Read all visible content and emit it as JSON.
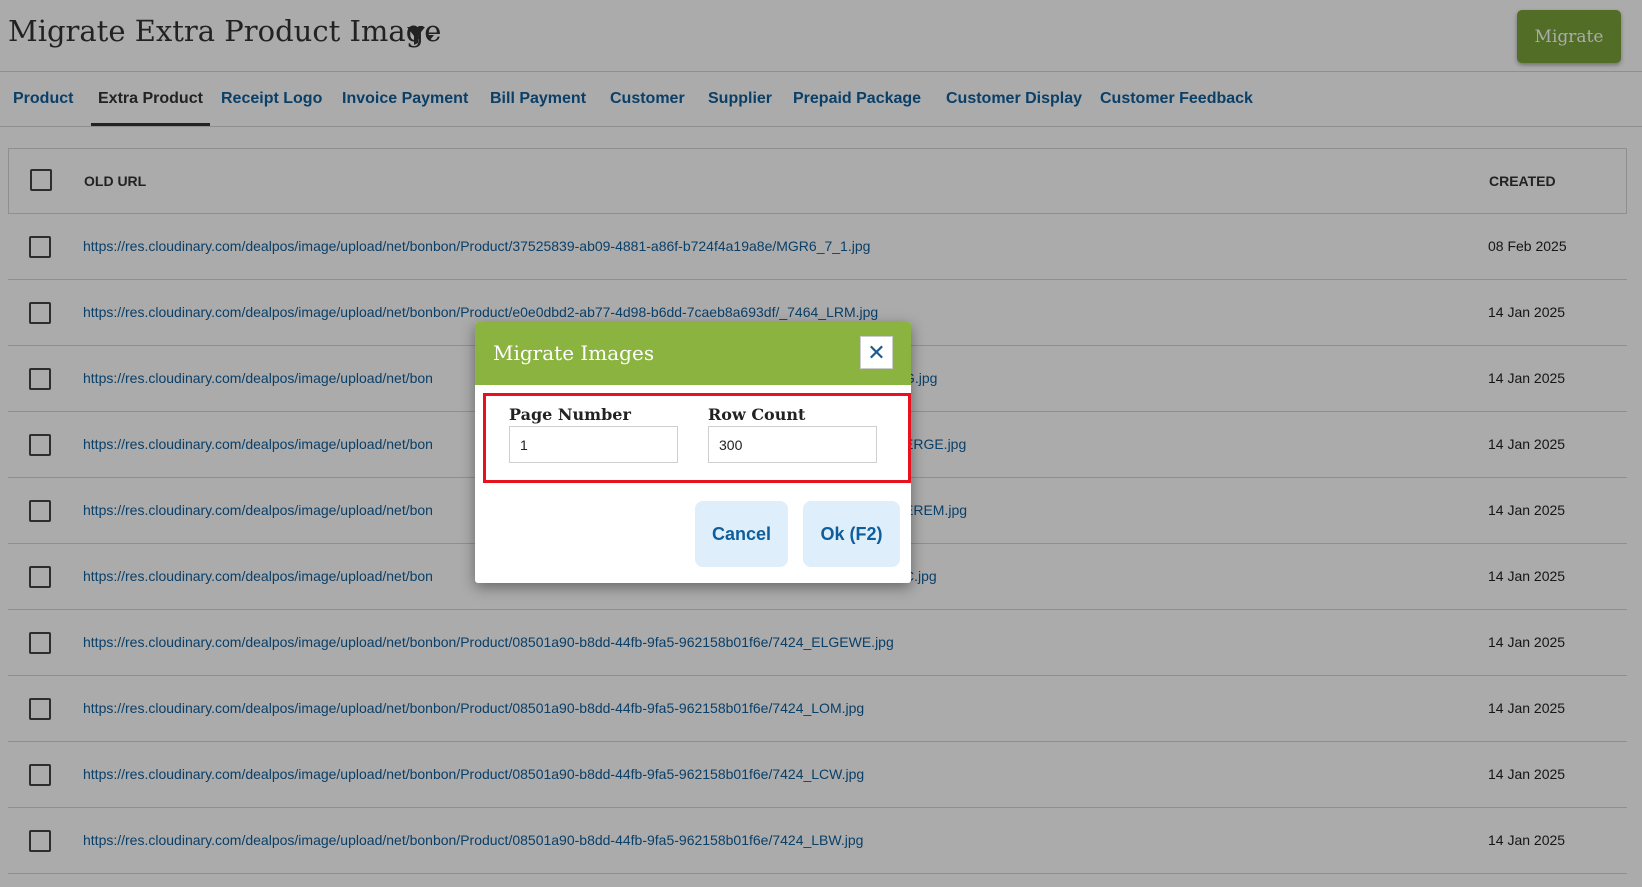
{
  "header": {
    "title": "Migrate Extra Product Image",
    "filter_icon": "filter-dropdown-icon",
    "migrate_label": "Migrate"
  },
  "tabs": [
    {
      "label": "Product"
    },
    {
      "label": "Extra Product",
      "active": true
    },
    {
      "label": "Receipt Logo"
    },
    {
      "label": "Invoice Payment"
    },
    {
      "label": "Bill Payment"
    },
    {
      "label": "Customer"
    },
    {
      "label": "Supplier"
    },
    {
      "label": "Prepaid Package"
    },
    {
      "label": "Customer Display"
    },
    {
      "label": "Customer Feedback"
    }
  ],
  "table": {
    "columns": {
      "old_url": "OLD URL",
      "created": "CREATED"
    },
    "rows": [
      {
        "url": "https://res.cloudinary.com/dealpos/image/upload/net/bonbon/Product/37525839-ab09-4881-a86f-b724f4a19a8e/MGR6_7_1.jpg",
        "created": "08 Feb 2025"
      },
      {
        "url": "https://res.cloudinary.com/dealpos/image/upload/net/bonbon/Product/e0e0dbd2-ab77-4d98-b6dd-7caeb8a693df/_7464_LRM.jpg",
        "created": "14 Jan 2025"
      },
      {
        "url": "https://res.cloudinary.com/dealpos/image/upload/net/bon",
        "url_tail": "G.jpg",
        "created": "14 Jan 2025"
      },
      {
        "url": "https://res.cloudinary.com/dealpos/image/upload/net/bon",
        "url_tail": "ERGE.jpg",
        "created": "14 Jan 2025"
      },
      {
        "url": "https://res.cloudinary.com/dealpos/image/upload/net/bon",
        "url_tail": "EREM.jpg",
        "created": "14 Jan 2025"
      },
      {
        "url": "https://res.cloudinary.com/dealpos/image/upload/net/bon",
        "url_tail": "C.jpg",
        "created": "14 Jan 2025"
      },
      {
        "url": "https://res.cloudinary.com/dealpos/image/upload/net/bonbon/Product/08501a90-b8dd-44fb-9fa5-962158b01f6e/7424_ELGEWE.jpg",
        "created": "14 Jan 2025"
      },
      {
        "url": "https://res.cloudinary.com/dealpos/image/upload/net/bonbon/Product/08501a90-b8dd-44fb-9fa5-962158b01f6e/7424_LOM.jpg",
        "created": "14 Jan 2025"
      },
      {
        "url": "https://res.cloudinary.com/dealpos/image/upload/net/bonbon/Product/08501a90-b8dd-44fb-9fa5-962158b01f6e/7424_LCW.jpg",
        "created": "14 Jan 2025"
      },
      {
        "url": "https://res.cloudinary.com/dealpos/image/upload/net/bonbon/Product/08501a90-b8dd-44fb-9fa5-962158b01f6e/7424_LBW.jpg",
        "created": "14 Jan 2025"
      }
    ]
  },
  "modal": {
    "title": "Migrate Images",
    "close_icon": "close-icon",
    "page_number_label": "Page Number",
    "page_number_value": "1",
    "row_count_label": "Row Count",
    "row_count_value": "300",
    "cancel_label": "Cancel",
    "ok_label": "Ok (F2)"
  },
  "colors": {
    "accent_green": "#7aa33a",
    "modal_header": "#8bb33f",
    "link_blue": "#0f5e9c",
    "highlight_red": "#e8121f",
    "button_bg": "#deeefb"
  }
}
